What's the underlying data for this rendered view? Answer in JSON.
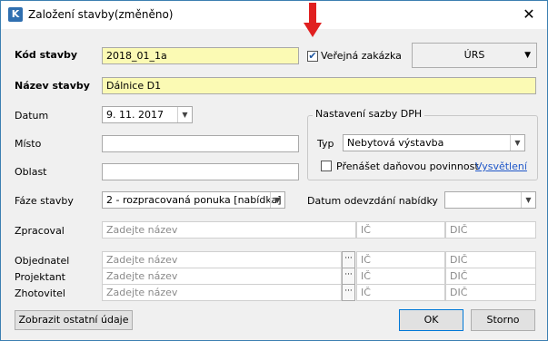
{
  "window": {
    "title": "Založení stavby(změněno)",
    "app_icon": "K",
    "close": "✕"
  },
  "code": {
    "label": "Kód stavby",
    "value": "2018_01_1a"
  },
  "public_contract": {
    "label": "Veřejná zakázka",
    "checked": true
  },
  "catalog": {
    "value": "ÚRS"
  },
  "name": {
    "label": "Název stavby",
    "value": "Dálnice D1"
  },
  "date": {
    "label": "Datum",
    "value": "9. 11. 2017"
  },
  "place": {
    "label": "Místo",
    "value": ""
  },
  "area": {
    "label": "Oblast",
    "value": ""
  },
  "vat": {
    "legend": "Nastavení sazby DPH",
    "type_label": "Typ",
    "type_value": "Nebytová výstavba",
    "transfer_label": "Přenášet daňovou povinnost",
    "transfer_checked": false,
    "explain_link": "Vysvětlení"
  },
  "phase": {
    "label": "Fáze stavby",
    "value": "2 - rozpracovaná ponuka [nabídka]"
  },
  "handover": {
    "label": "Datum odevzdání nabídky",
    "value": ""
  },
  "parties": {
    "placeholder": "Zadejte název",
    "ic_placeholder": "IČ",
    "dic_placeholder": "DIČ",
    "ellipsis": "···",
    "rows": [
      {
        "label": "Zpracoval"
      },
      {
        "label": "Objednatel"
      },
      {
        "label": "Projektant"
      },
      {
        "label": "Zhotovitel"
      }
    ]
  },
  "buttons": {
    "show_other": "Zobrazit ostatní údaje",
    "ok": "OK",
    "cancel": "Storno"
  },
  "colors": {
    "required": "#fbfab4",
    "arrow": "#e02020",
    "link": "#1e56c8"
  }
}
